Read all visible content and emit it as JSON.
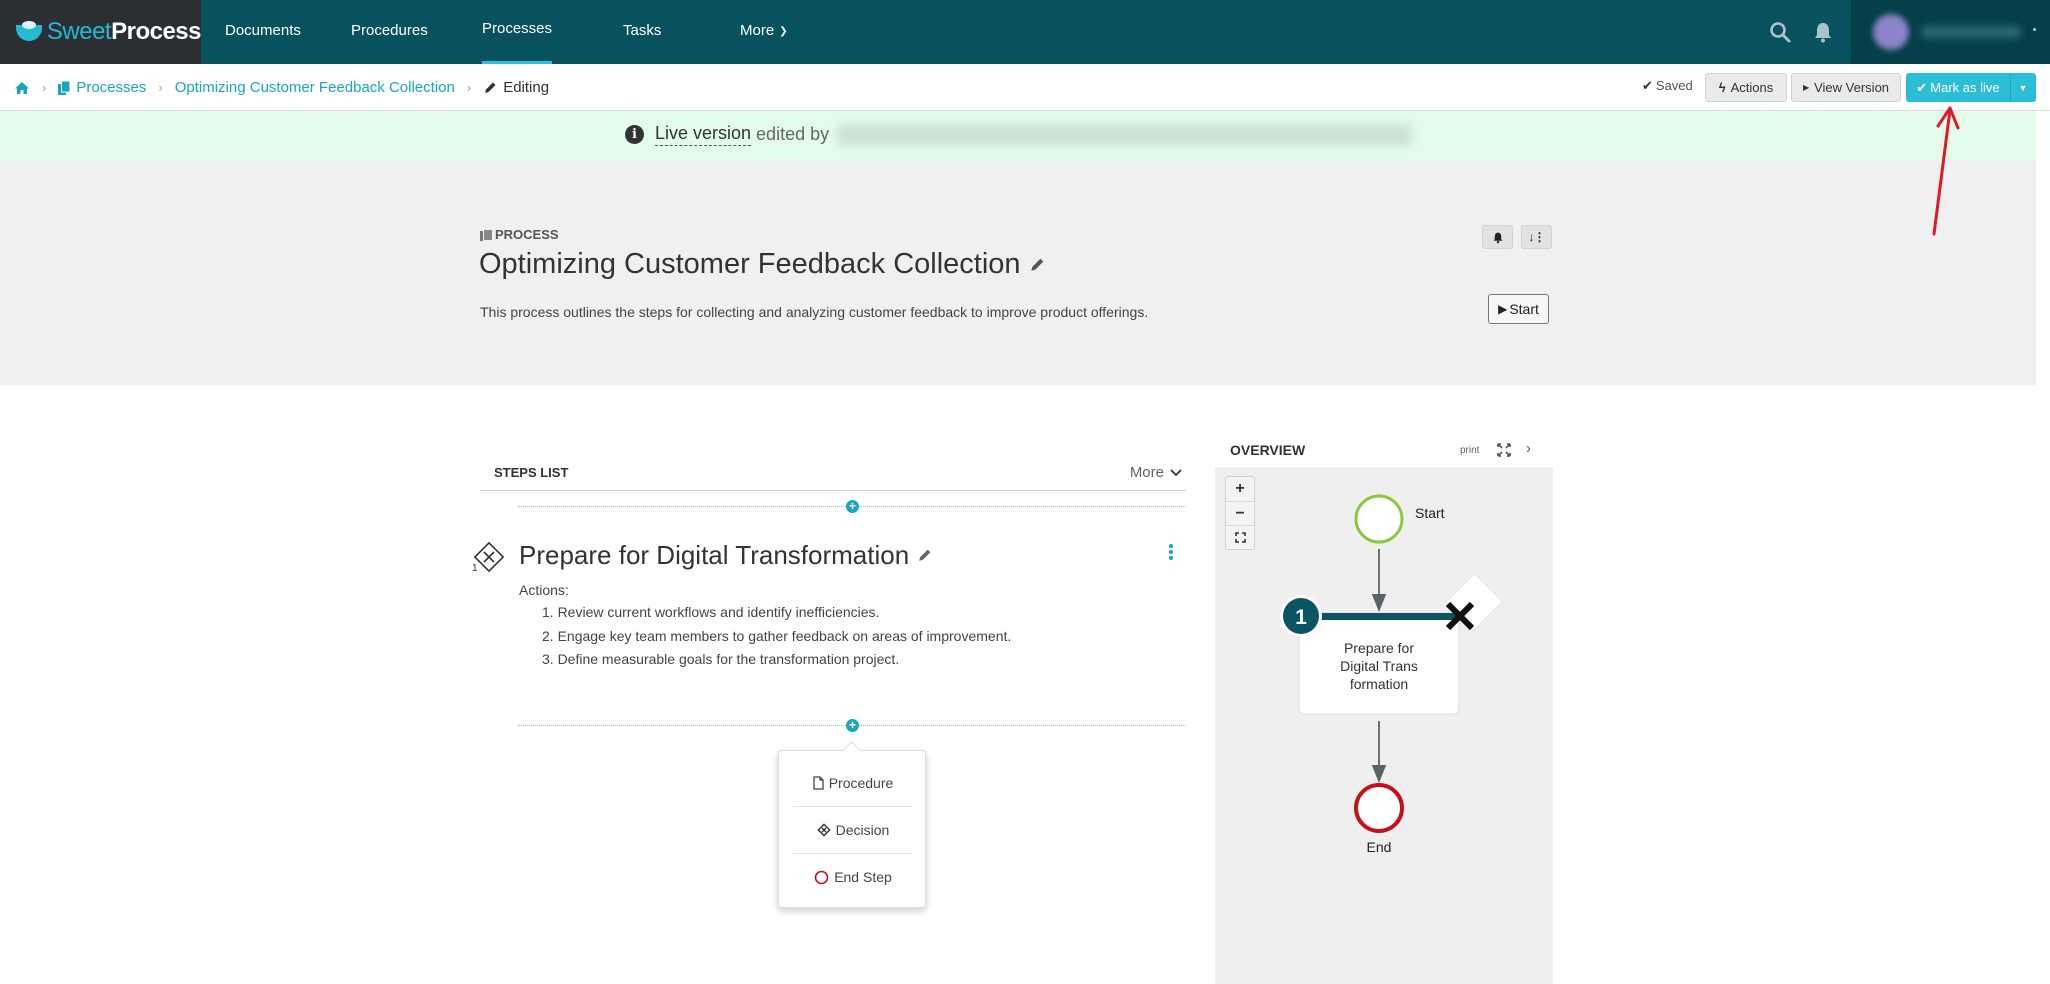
{
  "app": {
    "logo_part1": "Sweet",
    "logo_part2": "Process"
  },
  "nav": {
    "items": [
      {
        "label": "Documents",
        "active": false
      },
      {
        "label": "Procedures",
        "active": false
      },
      {
        "label": "Processes",
        "active": true
      },
      {
        "label": "Tasks",
        "active": false
      },
      {
        "label": "More",
        "active": false
      }
    ],
    "icons": [
      "search-icon",
      "bell-icon"
    ],
    "user": {
      "name": "(blurred)"
    }
  },
  "breadcrumb": {
    "home_icon": "home-icon",
    "items": [
      "Processes",
      "Optimizing Customer Feedback Collection"
    ],
    "current": "Editing"
  },
  "toolbar": {
    "saved_label": "Saved",
    "actions_label": "Actions",
    "view_version_label": "View Version",
    "mark_live_label": "Mark as live"
  },
  "banner": {
    "link_text": "Live version",
    "text": "edited by",
    "details": "(blurred)"
  },
  "process": {
    "type_label": "PROCESS",
    "title": "Optimizing Customer Feedback Collection",
    "description": "This process outlines the steps for collecting and analyzing customer feedback to improve product offerings.",
    "start_label": "Start"
  },
  "steps_list": {
    "title": "STEPS LIST",
    "more_label": "More",
    "steps": [
      {
        "number": "1",
        "type": "decision",
        "title": "Prepare for Digital Transformation",
        "actions_label": "Actions:",
        "actions": [
          "1. Review current workflows and identify inefficiencies.",
          "2. Engage key team members to gather feedback on areas of improvement.",
          "3. Define measurable goals for the transformation project."
        ]
      }
    ]
  },
  "add_popup": {
    "items": [
      {
        "label": "Procedure",
        "icon": "document-icon"
      },
      {
        "label": "Decision",
        "icon": "decision-icon"
      },
      {
        "label": "End Step",
        "icon": "end-circle-icon"
      }
    ]
  },
  "overview": {
    "title": "OVERVIEW",
    "print_label": "print",
    "zoom_in": "+",
    "zoom_out": "−",
    "flow": {
      "start_label": "Start",
      "step_number": "1",
      "step_text_lines": [
        "Prepare for",
        "Digital Trans",
        "formation"
      ],
      "end_label": "End"
    }
  },
  "colors": {
    "nav_bg": "#08525f",
    "logo_bg": "#2b2f33",
    "accent": "#1aa7bd",
    "mark_live": "#2bbed6",
    "banner_bg": "#e3fbe9",
    "header_bg": "#f0f0f0",
    "start_green": "#8dc63f",
    "end_red": "#c4111b",
    "step_teal": "#0b5461"
  }
}
